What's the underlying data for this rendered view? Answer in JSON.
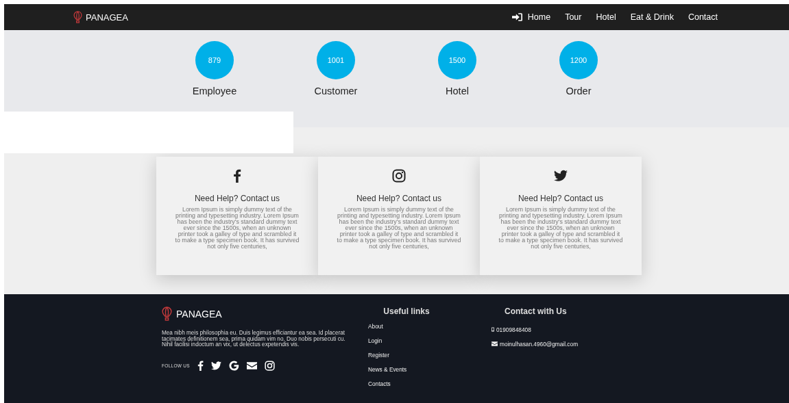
{
  "navbar": {
    "brand": "PANAGEA",
    "links": [
      {
        "label": "Home",
        "kind": "signin"
      },
      {
        "label": "Tour"
      },
      {
        "label": "Hotel"
      },
      {
        "label": "Eat & Drink"
      },
      {
        "label": "Contact"
      }
    ]
  },
  "stats": [
    {
      "value": "879",
      "label": "Employee"
    },
    {
      "value": "1001",
      "label": "Customer"
    },
    {
      "value": "1500",
      "label": "Hotel"
    },
    {
      "value": "1200",
      "label": "Order"
    }
  ],
  "cards": [
    {
      "kind": "facebook",
      "title": "Need Help? Contact us",
      "text": "Lorem Ipsum is simply dummy text of the printing and typesetting industry. Lorem Ipsum has been the industry's standard dummy text ever since the 1500s, when an unknown printer took a galley of type and scrambled it to make a type specimen book. It has survived not only five centuries,"
    },
    {
      "kind": "instagram",
      "title": "Need Help? Contact us",
      "text": "Lorem Ipsum is simply dummy text of the printing and typesetting industry. Lorem Ipsum has been the industry's standard dummy text ever since the 1500s, when an unknown printer took a galley of type and scrambled it to make a type specimen book. It has survived not only five centuries,"
    },
    {
      "kind": "twitter",
      "title": "Need Help? Contact us",
      "text": "Lorem Ipsum is simply dummy text of the printing and typesetting industry. Lorem Ipsum has been the industry's standard dummy text ever since the 1500s, when an unknown printer took a galley of type and scrambled it to make a type specimen book. It has survived not only five centuries,"
    }
  ],
  "footer": {
    "brand": "PANAGEA",
    "about": "Mea nibh meis philosophia eu. Duis legimus efficiantur ea sea. Id placerat tacimates definitionem sea, prima quidam vim no. Duo nobis persecuti cu. Nihil facilisi indoctum an vix, ut delectus expetendis vis.",
    "follow_label": "FOLLOW US",
    "socials": [
      {
        "kind": "facebook"
      },
      {
        "kind": "twitter"
      },
      {
        "kind": "google"
      },
      {
        "kind": "email"
      },
      {
        "kind": "instagram"
      }
    ],
    "useful_links": {
      "title": "Useful links",
      "links": [
        "About",
        "Login",
        "Register",
        "News & Events",
        "Contacts"
      ]
    },
    "contact": {
      "title": "Contact with Us",
      "items": [
        {
          "kind": "phone",
          "text": "01909848408"
        },
        {
          "kind": "email",
          "text": "moinulhasan.4960@gmail.com"
        }
      ]
    }
  }
}
